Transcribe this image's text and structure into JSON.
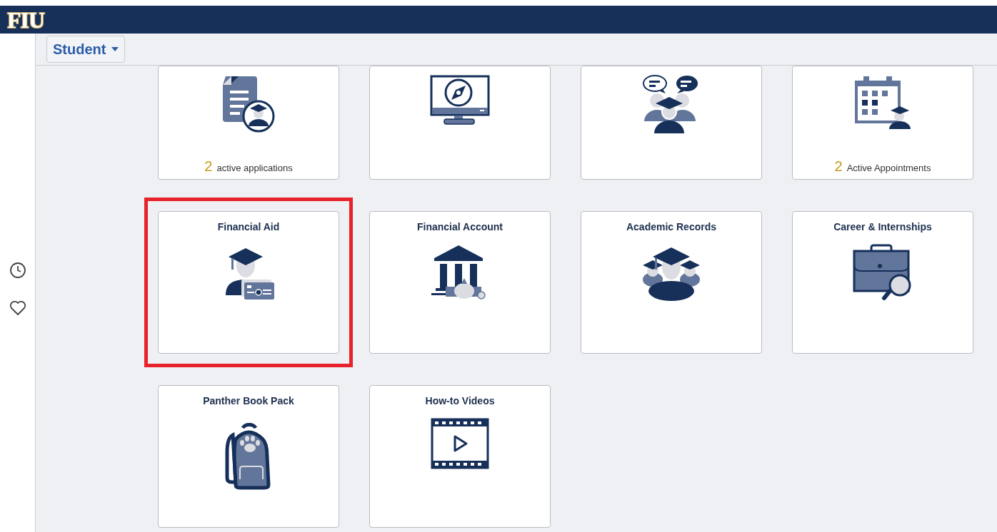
{
  "header": {
    "logo": "FIU"
  },
  "nav": {
    "menu_label": "Student"
  },
  "tiles": [
    {
      "count": "2",
      "count_label": "active applications",
      "highlighted": false
    },
    {
      "highlighted": false
    },
    {
      "highlighted": false
    },
    {
      "count": "2",
      "count_label": "Active Appointments",
      "highlighted": false
    },
    {
      "title": "Financial Aid",
      "highlighted": true
    },
    {
      "title": "Financial Account",
      "highlighted": false
    },
    {
      "title": "Academic Records",
      "highlighted": false
    },
    {
      "title": "Career & Internships",
      "highlighted": false
    },
    {
      "title": "Panther Book Pack",
      "highlighted": false
    },
    {
      "title": "How-to Videos",
      "highlighted": false
    }
  ]
}
